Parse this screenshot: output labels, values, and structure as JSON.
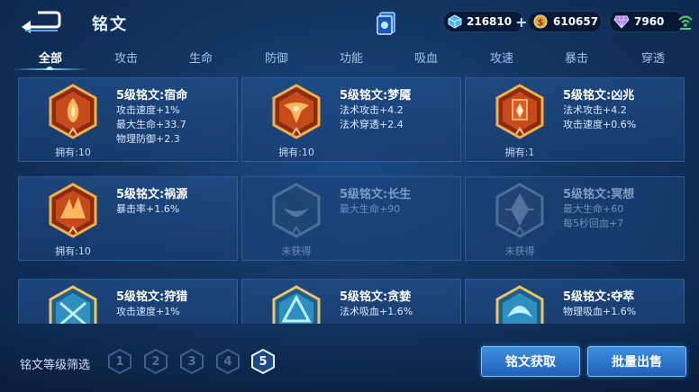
{
  "header": {
    "title": "铭文",
    "currencies": {
      "cube": "216810",
      "coin": "610657",
      "gem": "7960"
    }
  },
  "tabs": [
    "全部",
    "攻击",
    "生命",
    "防御",
    "功能",
    "吸血",
    "攻速",
    "暴击",
    "穿透"
  ],
  "inscriptions": [
    {
      "name": "5级铭文:宿命",
      "stats": [
        "攻击速度+1%",
        "最大生命+33.7",
        "物理防御+2.3"
      ],
      "owned": "拥有:10",
      "color": "red"
    },
    {
      "name": "5级铭文:梦魇",
      "stats": [
        "法术攻击+4.2",
        "法术穿透+2.4"
      ],
      "owned": "拥有:10",
      "color": "red"
    },
    {
      "name": "5级铭文:凶兆",
      "stats": [
        "法术攻击+4.2",
        "攻击速度+0.6%"
      ],
      "owned": "拥有:1",
      "color": "red"
    },
    {
      "name": "5级铭文:祸源",
      "stats": [
        "暴击率+1.6%"
      ],
      "owned": "拥有:10",
      "color": "red"
    },
    {
      "name": "5级铭文:长生",
      "stats": [
        "最大生命+90"
      ],
      "owned": "未获得",
      "color": "blue-locked"
    },
    {
      "name": "5级铭文:冥想",
      "stats": [
        "最大生命+60",
        "每5秒回血+7"
      ],
      "owned": "未获得",
      "color": "blue-locked"
    },
    {
      "name": "5级铭文:狩猎",
      "stats": [
        "攻击速度+1%"
      ],
      "owned": "",
      "color": "blue"
    },
    {
      "name": "5级铭文:贪婪",
      "stats": [
        "法术吸血+1.6%"
      ],
      "owned": "",
      "color": "blue"
    },
    {
      "name": "5级铭文:夺萃",
      "stats": [
        "物理吸血+1.6%"
      ],
      "owned": "",
      "color": "blue"
    }
  ],
  "filter": {
    "label": "铭文等级筛选",
    "levels": [
      "1",
      "2",
      "3",
      "4",
      "5"
    ],
    "selected": "5"
  },
  "buttons": {
    "obtain": "铭文获取",
    "sell": "批量出售"
  }
}
